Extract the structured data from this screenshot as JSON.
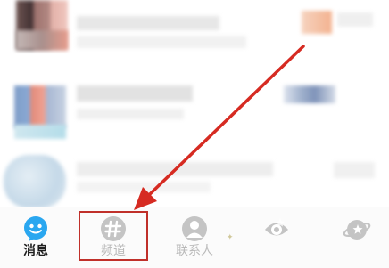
{
  "tabbar": {
    "tabs": [
      {
        "label": "消息",
        "icon": "chat-bubble-icon",
        "active": true
      },
      {
        "label": "频道",
        "icon": "hash-channel-icon",
        "active": false
      },
      {
        "label": "联系人",
        "icon": "contact-person-icon",
        "active": false
      },
      {
        "label": "",
        "icon": "star-eye-icon",
        "active": false
      },
      {
        "label": "",
        "icon": "planet-icon",
        "active": false
      }
    ]
  },
  "colors": {
    "accent": "#2aa7f0",
    "annotation": "#d62b22",
    "inactive": "#b9b9b9"
  }
}
